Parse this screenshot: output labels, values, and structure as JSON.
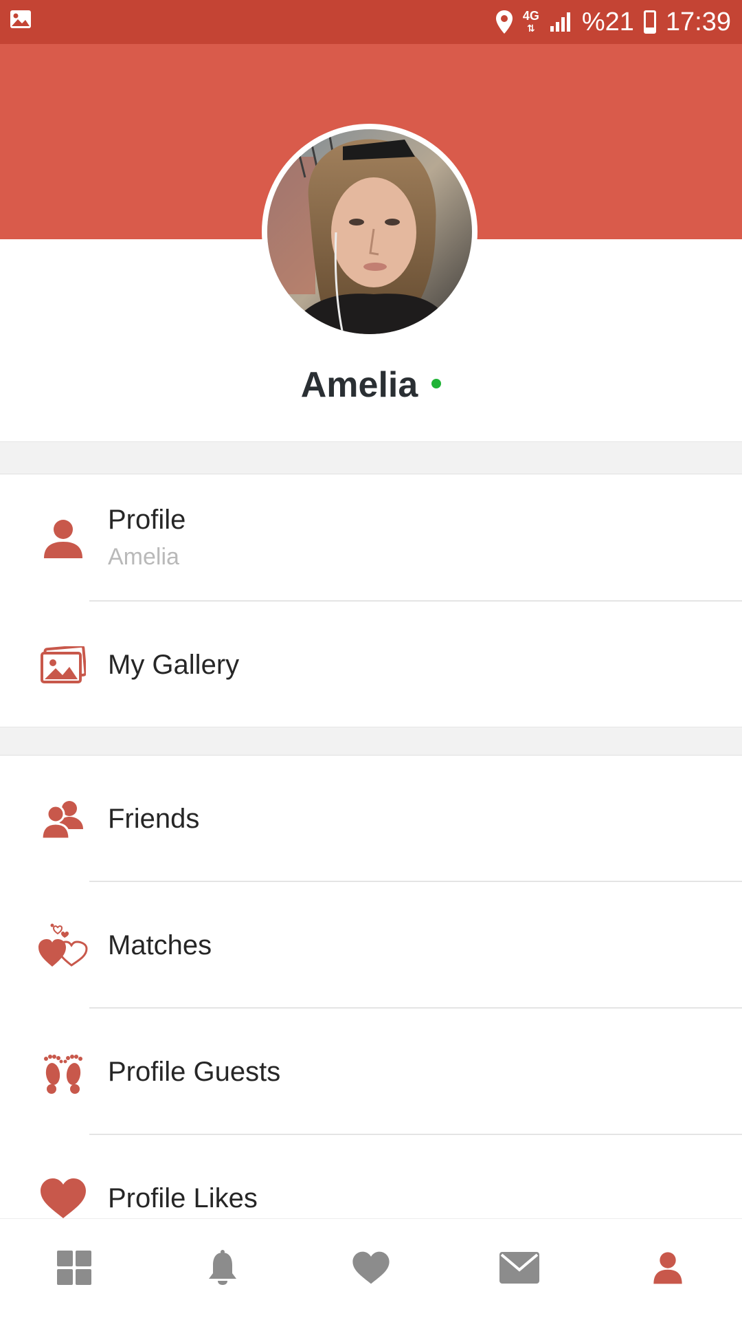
{
  "status_bar": {
    "network_top": "4G",
    "battery_percent": "%21",
    "time": "17:39",
    "icons": [
      "image-icon",
      "location-icon",
      "network-4g-icon",
      "signal-icon",
      "battery-icon"
    ]
  },
  "profile": {
    "name": "Amelia",
    "online": true,
    "online_color": "#1fb336"
  },
  "menu": {
    "section1": [
      {
        "label": "Profile",
        "sub": "Amelia",
        "icon": "person-icon"
      },
      {
        "label": "My Gallery",
        "icon": "gallery-icon"
      }
    ],
    "section2": [
      {
        "label": "Friends",
        "icon": "friends-icon"
      },
      {
        "label": "Matches",
        "icon": "matches-hearts-icon"
      },
      {
        "label": "Profile Guests",
        "icon": "footprints-icon"
      },
      {
        "label": "Profile Likes",
        "icon": "heart-icon"
      }
    ]
  },
  "bottom_nav": {
    "tabs": [
      {
        "icon": "grid-icon",
        "active": false
      },
      {
        "icon": "bell-icon",
        "active": false
      },
      {
        "icon": "heart-icon",
        "active": false
      },
      {
        "icon": "mail-icon",
        "active": false
      },
      {
        "icon": "person-icon",
        "active": true
      }
    ]
  },
  "colors": {
    "status_bar": "#c44434",
    "header": "#d95b4b",
    "accent_icon": "#c8584b",
    "inactive_nav": "#8c8c8c"
  }
}
